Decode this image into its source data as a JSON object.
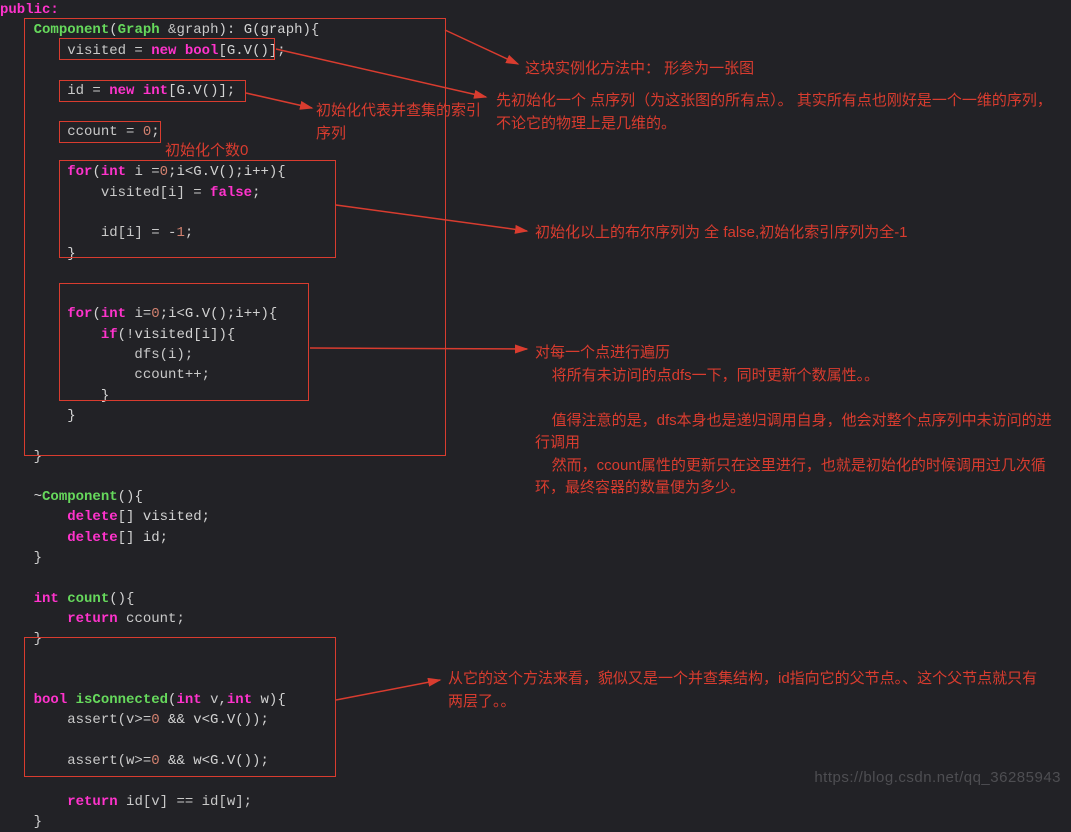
{
  "code": {
    "line1": "public:",
    "line2_a": "Component",
    "line2_b": "(",
    "line2_c": "Graph",
    "line2_d": " &",
    "line2_e": "graph",
    "line2_f": "): G(graph){",
    "line3_a": "visited = ",
    "line3_b": "new",
    "line3_c": " bool",
    "line3_d": "[G.V()];",
    "line5_a": "id = ",
    "line5_b": "new",
    "line5_c": " int",
    "line5_d": "[G.V()];",
    "line7_a": "ccount = ",
    "line7_b": "0",
    "line7_c": ";",
    "line9_a": "for",
    "line9_b": "(",
    "line9_c": "int",
    "line9_d": " i =",
    "line9_e": "0",
    "line9_f": ";i<G.V();i++){",
    "line10_a": "visited[i] = ",
    "line10_b": "false",
    "line10_c": ";",
    "line12_a": "id[i] = -",
    "line12_b": "1",
    "line12_c": ";",
    "line13": "}",
    "line16_a": "for",
    "line16_b": "(",
    "line16_c": "int",
    "line16_d": " i=",
    "line16_e": "0",
    "line16_f": ";i<G.V();i++){",
    "line17_a": "if",
    "line17_b": "(!visited[i]){",
    "line18": "dfs(i);",
    "line19": "ccount++;",
    "line20": "}",
    "line21": "}",
    "line23": "}",
    "line25_a": "~",
    "line25_b": "Component",
    "line25_c": "(){",
    "line26_a": "delete",
    "line26_b": "[] visited;",
    "line27_a": "delete",
    "line27_b": "[] id;",
    "line28": "}",
    "line30_a": "int",
    "line30_b": " count",
    "line30_c": "(){",
    "line31_a": "return",
    "line31_b": " ccount;",
    "line32": "}",
    "line35_a": "bool",
    "line35_b": " isConnected",
    "line35_c": "(",
    "line35_d": "int",
    "line35_e": " v,",
    "line35_f": "int",
    "line35_g": " w){",
    "line36_a": "assert(v>=",
    "line36_b": "0",
    "line36_c": " && v<G.V());",
    "line38_a": "assert(w>=",
    "line38_b": "0",
    "line38_c": " && w<G.V());",
    "line40_a": "return",
    "line40_b": " id[v] == id[w];",
    "line41": "}"
  },
  "annotations": {
    "a1": "这块实例化方法中：   形参为一张图",
    "a2": "先初始化一个  点序列（为这张图的所有点）。   其实所有点也刚好是一个一维的序列，不论它的物理上是几维的。",
    "a3": "初始化代表并查集的索引序列",
    "a4": "初始化个数0",
    "a5": "初始化以上的布尔序列为  全 false,初始化索引序列为全-1",
    "a6": "对每一个点进行遍历\n    将所有未访问的点dfs一下，同时更新个数属性。。\n\n    值得注意的是，dfs本身也是递归调用自身，他会对整个点序列中未访问的进行调用\n    然而，ccount属性的更新只在这里进行，也就是初始化的时候调用过几次循环，最终容器的数量便为多少。",
    "a7": "从它的这个方法来看，貌似又是一个并查集结构，id指向它的父节点。、这个父节点就只有两层了。。"
  },
  "watermark": "https://blog.csdn.net/qq_36285943"
}
